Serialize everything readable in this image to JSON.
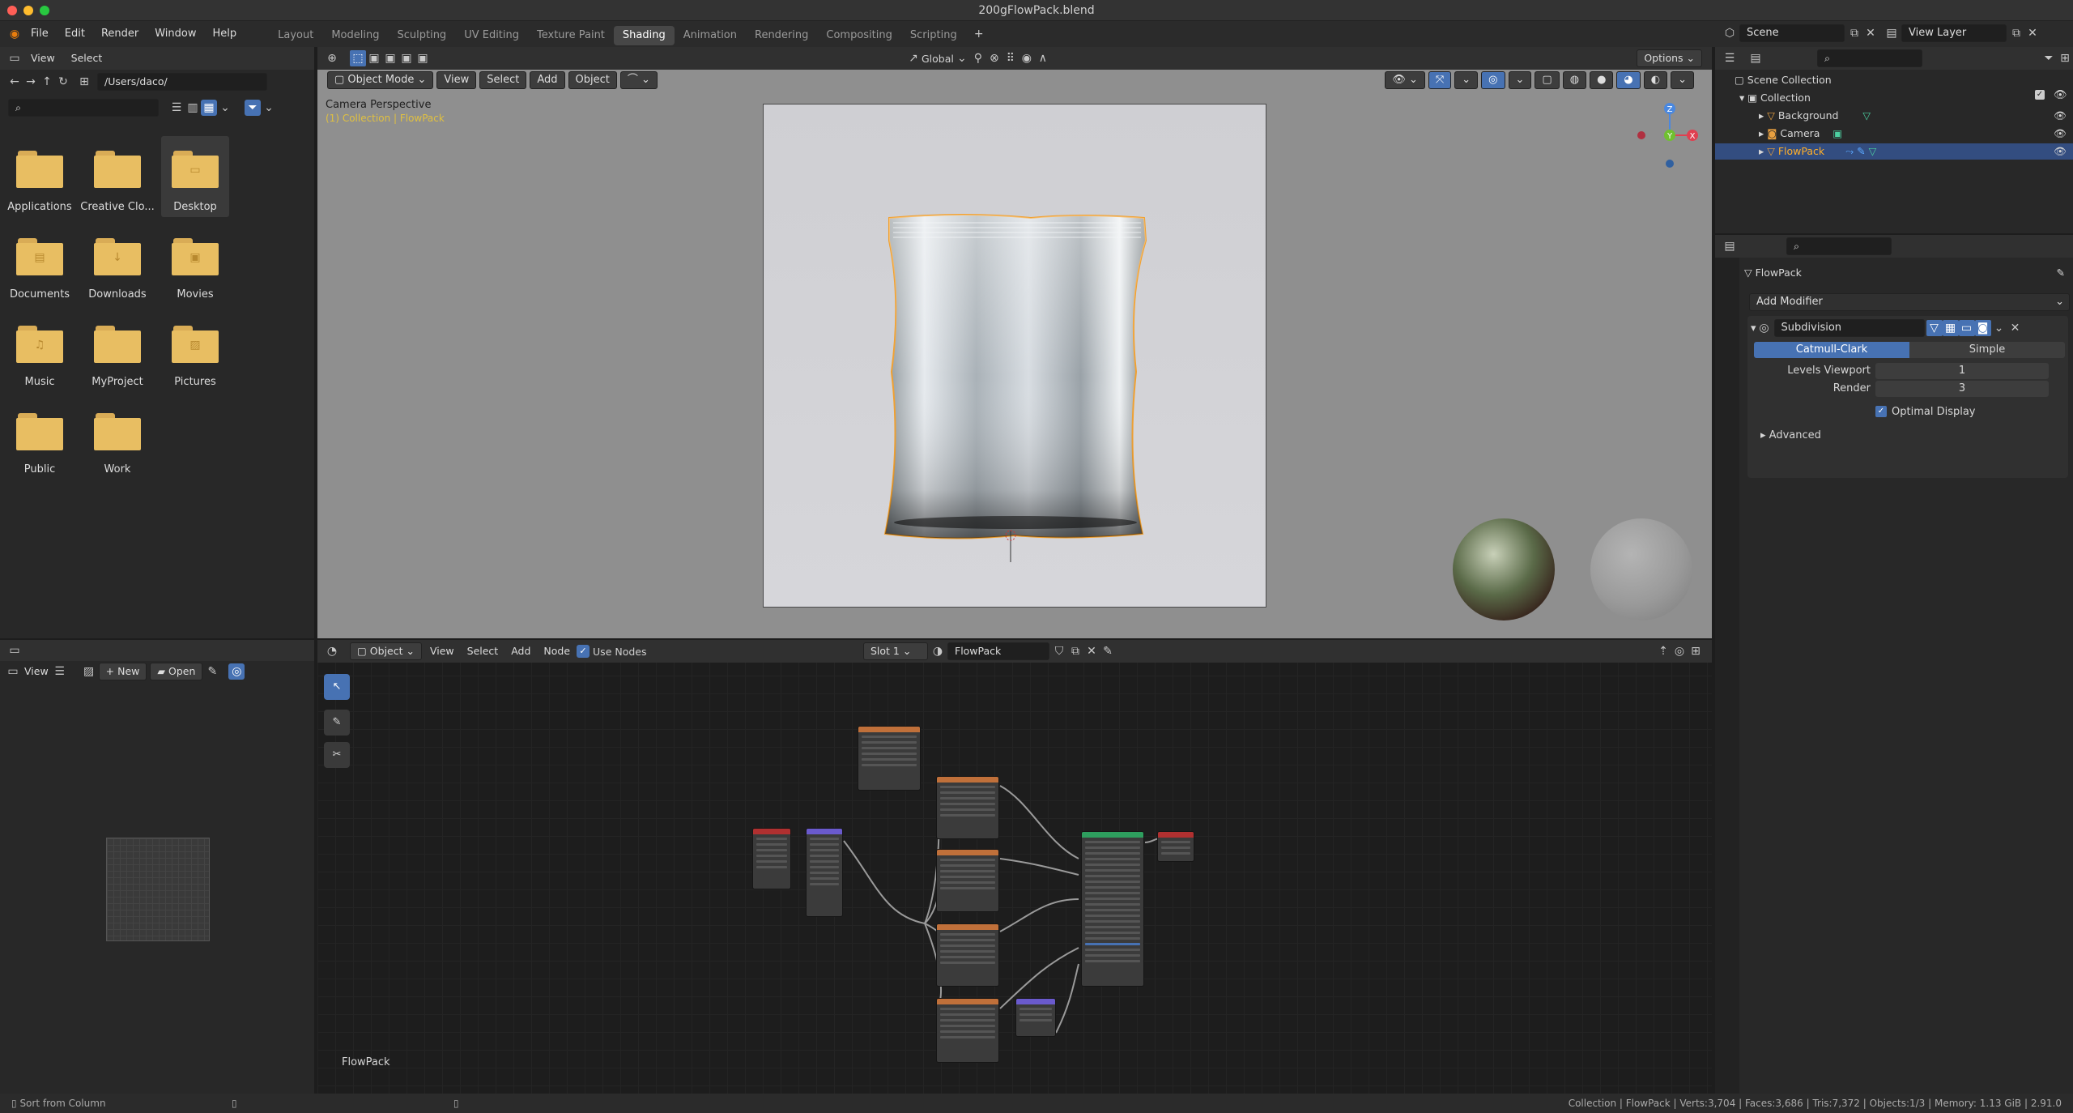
{
  "window": {
    "title": "200gFlowPack.blend"
  },
  "menu": {
    "items": [
      "File",
      "Edit",
      "Render",
      "Window",
      "Help"
    ]
  },
  "workspaces": [
    "Layout",
    "Modeling",
    "Sculpting",
    "UV Editing",
    "Texture Paint",
    "Shading",
    "Animation",
    "Rendering",
    "Compositing",
    "Scripting"
  ],
  "active_workspace": "Shading",
  "topright": {
    "scene": "Scene",
    "view_layer": "View Layer"
  },
  "filebrowser": {
    "menu": [
      "View",
      "Select"
    ],
    "path": "/Users/daco/",
    "items": [
      {
        "name": "Applications",
        "icon": "folder-icon"
      },
      {
        "name": "Creative Clo...",
        "icon": "folder-icon"
      },
      {
        "name": "Desktop",
        "icon": "folder-desktop-icon"
      },
      {
        "name": "Documents",
        "icon": "folder-documents-icon"
      },
      {
        "name": "Downloads",
        "icon": "folder-downloads-icon"
      },
      {
        "name": "Movies",
        "icon": "folder-movies-icon"
      },
      {
        "name": "Music",
        "icon": "folder-music-icon"
      },
      {
        "name": "MyProject",
        "icon": "folder-icon"
      },
      {
        "name": "Pictures",
        "icon": "folder-pictures-icon"
      },
      {
        "name": "Public",
        "icon": "folder-icon"
      },
      {
        "name": "Work",
        "icon": "folder-icon"
      }
    ]
  },
  "imageeditor": {
    "view": "View",
    "new": "New",
    "open": "Open"
  },
  "viewport": {
    "orientation": "Global",
    "options": "Options",
    "mode": "Object Mode",
    "menus": [
      "View",
      "Select",
      "Add",
      "Object"
    ],
    "camera_label": "Camera Perspective",
    "collection_label": "(1) Collection | FlowPack"
  },
  "nodeeditor": {
    "object": "Object",
    "menus": [
      "View",
      "Select",
      "Add",
      "Node"
    ],
    "use_nodes": "Use Nodes",
    "slot": "Slot 1",
    "material": "FlowPack",
    "footer_label": "FlowPack"
  },
  "outliner": {
    "root": "Scene Collection",
    "collection": "Collection",
    "objects": [
      {
        "name": "Background",
        "selected": false
      },
      {
        "name": "Camera",
        "selected": false
      },
      {
        "name": "FlowPack",
        "selected": true
      }
    ]
  },
  "properties": {
    "object": "FlowPack",
    "add_modifier": "Add Modifier",
    "modifier": "Subdivision",
    "catmull": "Catmull-Clark",
    "simple": "Simple",
    "levels_viewport_label": "Levels Viewport",
    "levels_viewport": "1",
    "render_label": "Render",
    "render": "3",
    "optimal_display": "Optimal Display",
    "advanced": "Advanced"
  },
  "status": {
    "left": "Sort from Column",
    "right": "Collection | FlowPack | Verts:3,704 | Faces:3,686 | Tris:7,372 | Objects:1/3 | Memory: 1.13 GiB | 2.91.0"
  },
  "colors": {
    "accent": "#4772b3",
    "selected_row": "#334d80",
    "orange_outline": "#f0a030",
    "header_bg": "#303030"
  }
}
